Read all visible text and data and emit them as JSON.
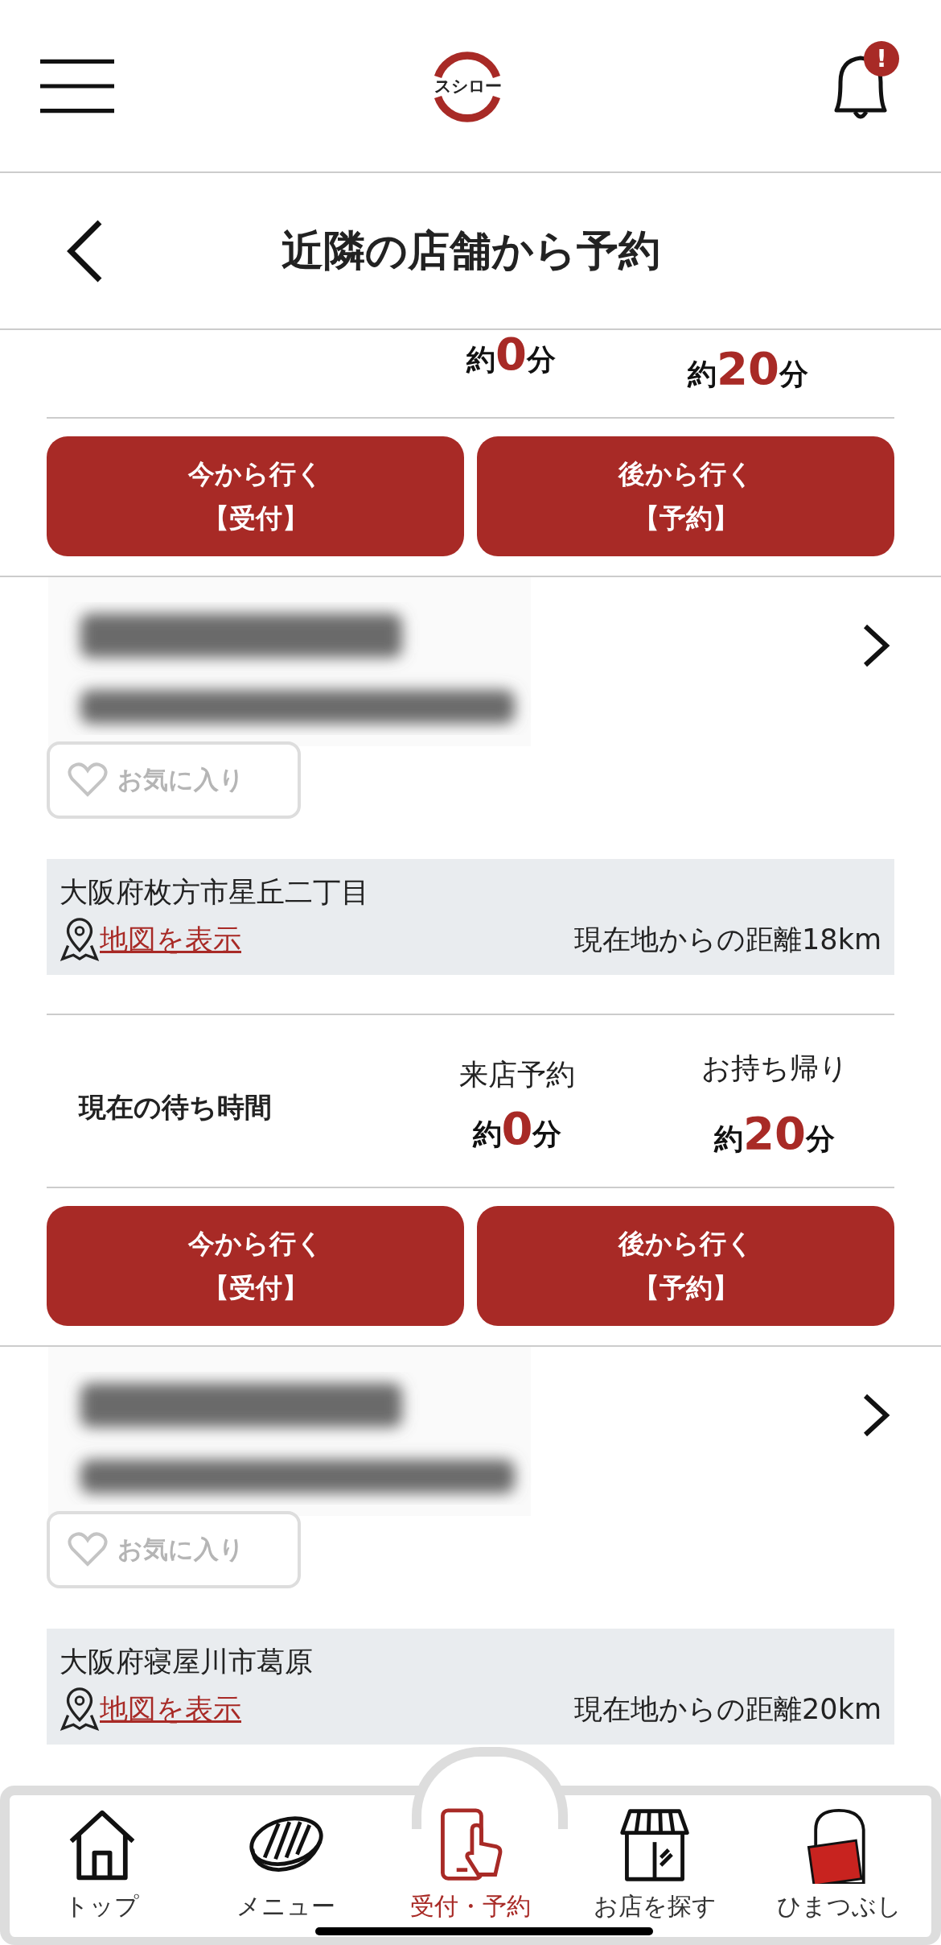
{
  "header": {
    "logo": "スシロー",
    "alert_badge": "!"
  },
  "page_title": "近隣の店舗から予約",
  "partial_wait": [
    {
      "prefix": "約",
      "number": "0",
      "unit": "分"
    },
    {
      "prefix": "約",
      "number": "20",
      "unit": "分"
    }
  ],
  "partial_buttons": [
    {
      "line1": "今から行く",
      "line2": "【受付】"
    },
    {
      "line1": "後から行く",
      "line2": "【予約】"
    }
  ],
  "stores": [
    {
      "favorite": {
        "label": "お気に入り",
        "selected": false
      },
      "address": "大阪府枚方市星丘二丁目",
      "map_link": "地図を表示",
      "distance": "現在地からの距離18km",
      "wait": {
        "label": "現在の待ち時間",
        "columns": [
          {
            "label": "来店予約",
            "prefix": "約",
            "number": "0",
            "unit": "分"
          },
          {
            "label": "お持ち帰り",
            "prefix": "約",
            "number": "20",
            "unit": "分"
          }
        ]
      },
      "buttons": [
        {
          "line1": "今から行く",
          "line2": "【受付】"
        },
        {
          "line1": "後から行く",
          "line2": "【予約】"
        }
      ]
    },
    {
      "favorite": {
        "label": "お気に入り",
        "selected": false
      },
      "address": "大阪府寝屋川市葛原",
      "map_link": "地図を表示",
      "distance": "現在地からの距離20km"
    }
  ],
  "bottom_nav": [
    {
      "kind": "home",
      "label": "トップ",
      "selected": false
    },
    {
      "kind": "sushi",
      "label": "メニュー",
      "selected": false
    },
    {
      "kind": "phone",
      "label": "受付・予約",
      "selected": true
    },
    {
      "kind": "shop",
      "label": "お店を探す",
      "selected": false
    },
    {
      "kind": "figure",
      "label": "ひまつぶし",
      "selected": false
    }
  ]
}
